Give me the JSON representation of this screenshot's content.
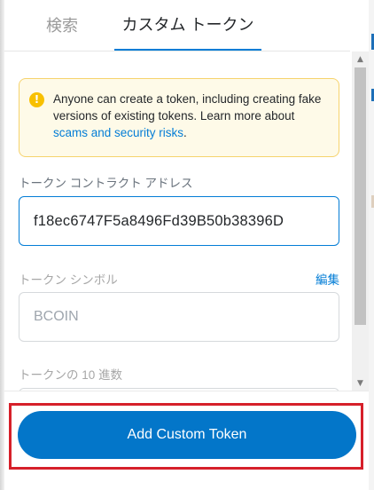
{
  "tabs": {
    "search_label": "検索",
    "custom_label": "カスタム トークン"
  },
  "warning": {
    "icon": "info-icon",
    "icon_glyph": "!",
    "text_before": "Anyone can create a token, including creating fake versions of existing tokens. Learn more about ",
    "link_text": "scams and security risks",
    "text_after": "."
  },
  "contract_address": {
    "label": "トークン コントラクト アドレス",
    "value": "f18ec6747F5a8496Fd39B50b38396D"
  },
  "token_symbol": {
    "label": "トークン シンボル",
    "edit_label": "編集",
    "value": "BCOIN"
  },
  "token_decimals": {
    "label": "トークンの 10 進数"
  },
  "scrollbar": {
    "up_glyph": "▲",
    "down_glyph": "▼"
  },
  "footer": {
    "add_button_label": "Add Custom Token"
  },
  "colors": {
    "accent": "#037dd6",
    "button": "#0376c9",
    "warning_bg": "#fefae8",
    "warning_border": "#f6d36d",
    "highlight": "#d6202a"
  }
}
